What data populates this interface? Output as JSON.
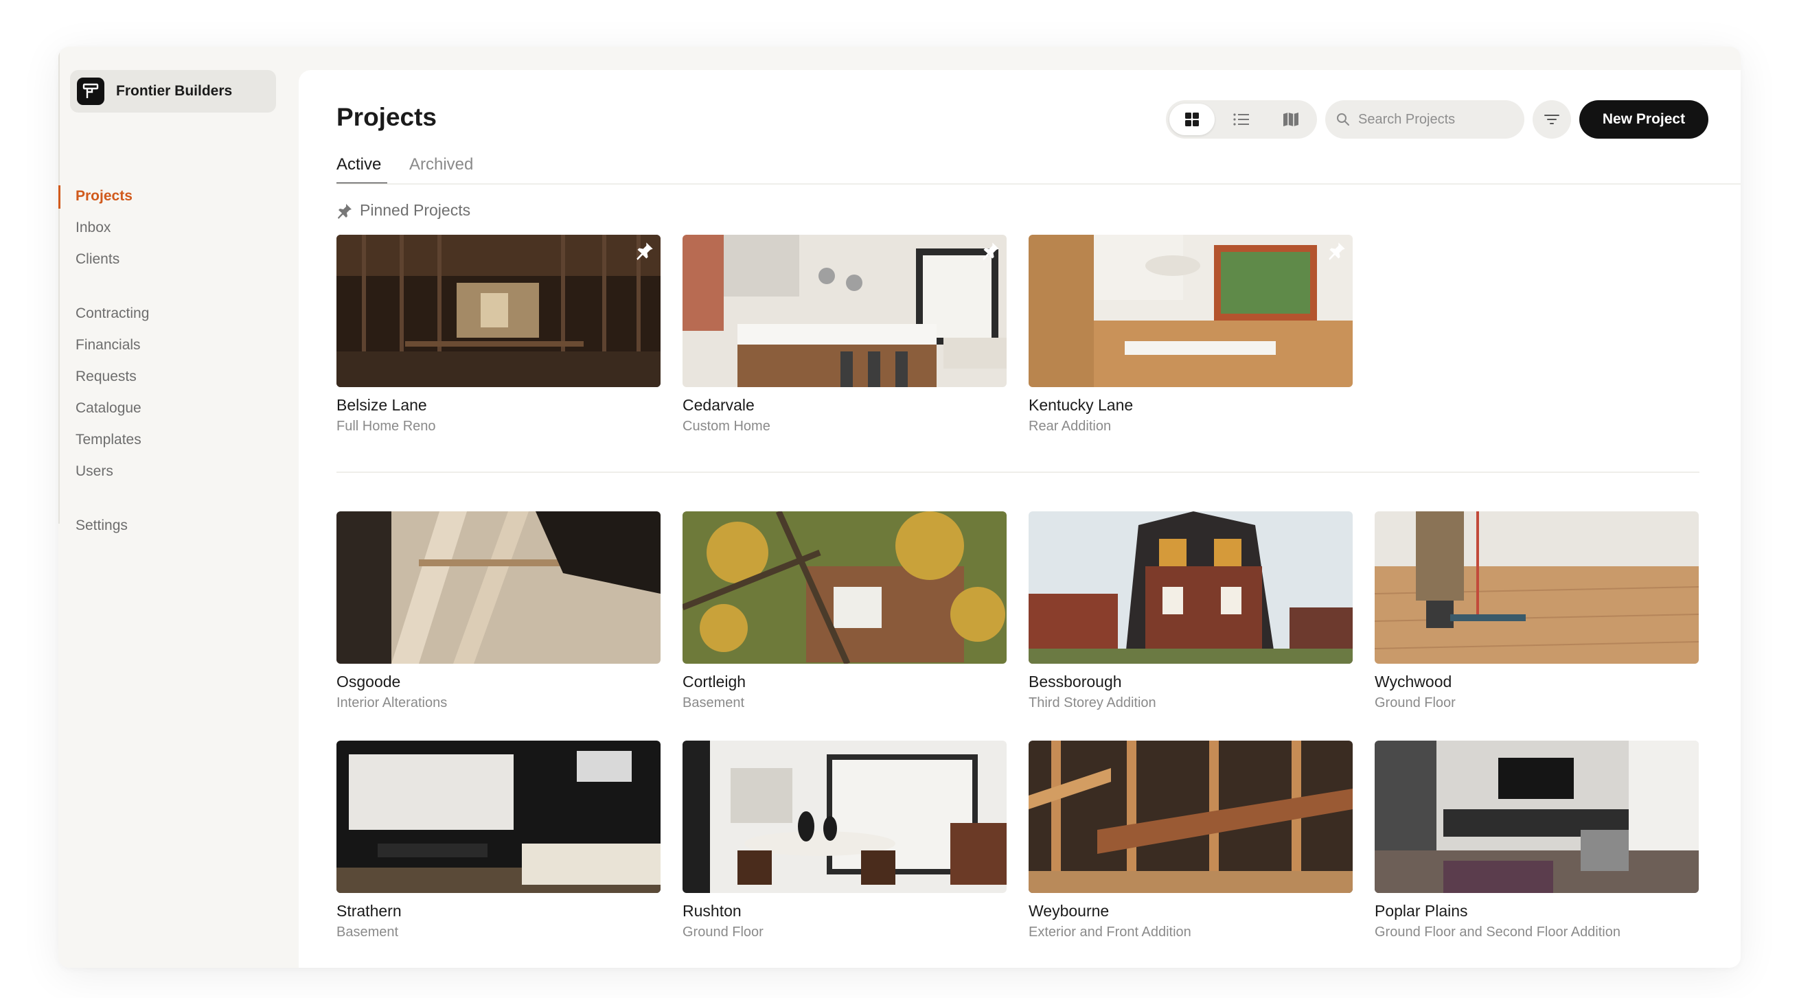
{
  "org": {
    "name": "Frontier Builders",
    "logo_icon": "frontier-logo-icon"
  },
  "sidebar": {
    "items": [
      {
        "label": "Projects",
        "active": true
      },
      {
        "label": "Inbox"
      },
      {
        "label": "Clients"
      },
      {
        "label": "Contracting"
      },
      {
        "label": "Financials"
      },
      {
        "label": "Requests"
      },
      {
        "label": "Catalogue"
      },
      {
        "label": "Templates"
      },
      {
        "label": "Users"
      },
      {
        "label": "Settings"
      }
    ],
    "accent_color": "#d15a1c"
  },
  "header": {
    "title": "Projects",
    "tabs": [
      {
        "label": "Active",
        "active": true
      },
      {
        "label": "Archived"
      }
    ]
  },
  "toolbar": {
    "views": [
      {
        "icon": "grid-view-icon",
        "active": true
      },
      {
        "icon": "list-view-icon"
      },
      {
        "icon": "map-view-icon"
      }
    ],
    "search_placeholder": "Search Projects",
    "filter_icon": "filter-icon",
    "new_project_label": "New Project"
  },
  "pinned": {
    "label": "Pinned Projects",
    "icon": "pin-icon",
    "projects": [
      {
        "title": "Belsize Lane",
        "subtitle": "Full Home Reno",
        "pinned": true
      },
      {
        "title": "Cedarvale",
        "subtitle": "Custom Home",
        "pinned": true
      },
      {
        "title": "Kentucky Lane",
        "subtitle": "Rear Addition",
        "pinned": true
      }
    ]
  },
  "projects": [
    {
      "title": "Osgoode",
      "subtitle": "Interior Alterations"
    },
    {
      "title": "Cortleigh",
      "subtitle": "Basement"
    },
    {
      "title": "Bessborough",
      "subtitle": "Third Storey Addition"
    },
    {
      "title": "Wychwood",
      "subtitle": "Ground Floor"
    },
    {
      "title": "Strathern",
      "subtitle": "Basement"
    },
    {
      "title": "Rushton",
      "subtitle": "Ground Floor"
    },
    {
      "title": "Weybourne",
      "subtitle": "Exterior and Front Addition"
    },
    {
      "title": "Poplar Plains",
      "subtitle": "Ground Floor and Second Floor Addition"
    }
  ]
}
